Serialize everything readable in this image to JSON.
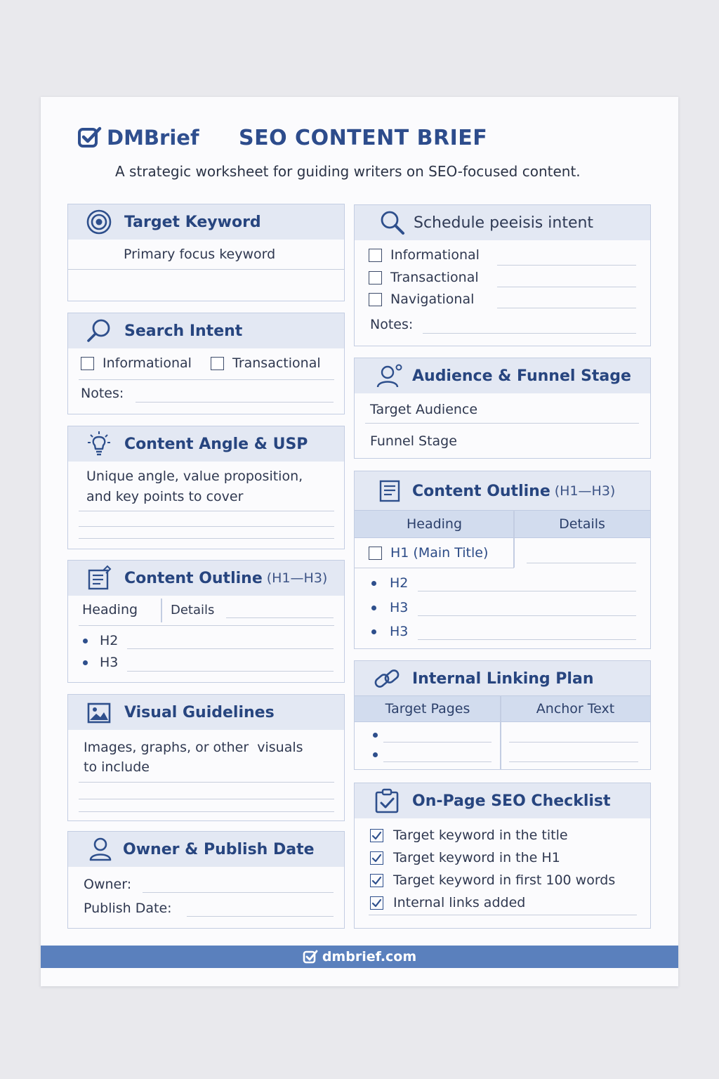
{
  "brand": {
    "name": "DMBrief",
    "icon": "checkbox-check-icon"
  },
  "title": "SEO CONTENT BRIEF",
  "subtitle": "A strategic worksheet for guiding writers on SEO-focused content.",
  "target_keyword": {
    "title": "Target Keyword",
    "icon": "target-icon",
    "label": "Primary focus keyword"
  },
  "search_intent": {
    "title": "Search Intent",
    "icon": "search-icon",
    "options": [
      "Informational",
      "Transactional"
    ],
    "notes_label": "Notes:"
  },
  "content_angle": {
    "title": "Content Angle & USP",
    "icon": "lightbulb-icon",
    "line1": "Unique angle, value proposition,",
    "line2": "and key points to cover"
  },
  "outline_left": {
    "title": "Content Outline",
    "range": "(H1—H3)",
    "icon": "document-icon",
    "col_heading": "Heading",
    "col_details": "Details",
    "items": [
      "H2",
      "H3"
    ]
  },
  "visual": {
    "title": "Visual Guidelines",
    "icon": "image-icon",
    "line1": "Images, graphs, or other  visuals",
    "line2": "to include"
  },
  "owner": {
    "title": "Owner & Publish Date",
    "icon": "user-icon",
    "owner_label": "Owner:",
    "date_label": "Publish Date:"
  },
  "schedule": {
    "title": "Schedule peeisis intent",
    "icon": "magnifier-icon",
    "options": [
      "Informational",
      "Transactional",
      "Navigational"
    ],
    "notes_label": "Notes:"
  },
  "audience": {
    "title": "Audience & Funnel Stage",
    "icon": "user-group-icon",
    "row1": "Target Audience",
    "row2": "Funnel Stage"
  },
  "outline_right": {
    "title": "Content Outline",
    "range": "(H1—H3)",
    "icon": "document-icon",
    "col_heading": "Heading",
    "col_details": "Details",
    "h1_label": "H1 (Main Title)",
    "items": [
      "H2",
      "H3",
      "H3"
    ]
  },
  "linking": {
    "title": "Internal Linking Plan",
    "icon": "link-icon",
    "col1": "Target Pages",
    "col2": "Anchor Text"
  },
  "checklist": {
    "title": "On-Page SEO Checklist",
    "icon": "clipboard-check-icon",
    "items": [
      "Target keyword in the title",
      "Target keyword in the H1",
      "Target keyword in first 100 words",
      "Internal links added"
    ]
  },
  "footer": {
    "url": "dmbrief.com",
    "icon": "checkbox-check-icon"
  },
  "colors": {
    "accent": "#2d4c8c",
    "header_bg": "#e3e8f3",
    "footer_bg": "#5a80bd"
  }
}
